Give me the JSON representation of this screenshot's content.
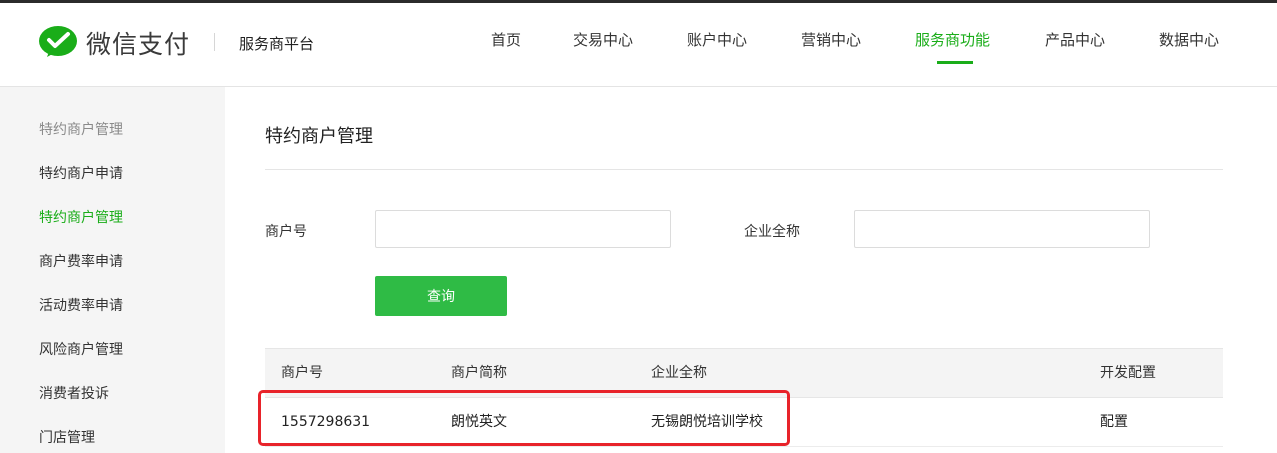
{
  "header": {
    "brand": "微信支付",
    "platform": "服务商平台",
    "nav": [
      {
        "label": "首页"
      },
      {
        "label": "交易中心"
      },
      {
        "label": "账户中心"
      },
      {
        "label": "营销中心"
      },
      {
        "label": "服务商功能",
        "active": true
      },
      {
        "label": "产品中心"
      },
      {
        "label": "数据中心"
      }
    ]
  },
  "sidebar": {
    "title": "特约商户管理",
    "items": [
      {
        "label": "特约商户申请"
      },
      {
        "label": "特约商户管理",
        "active": true
      },
      {
        "label": "商户费率申请"
      },
      {
        "label": "活动费率申请"
      },
      {
        "label": "风险商户管理"
      },
      {
        "label": "消费者投诉"
      },
      {
        "label": "门店管理"
      }
    ]
  },
  "main": {
    "title": "特约商户管理",
    "form": {
      "merchant_id_label": "商户号",
      "merchant_id_value": "",
      "company_label": "企业全称",
      "company_value": "",
      "query_label": "查询"
    },
    "table": {
      "columns": [
        "商户号",
        "商户简称",
        "企业全称",
        "开发配置"
      ],
      "rows": [
        {
          "merchant_id": "1557298631",
          "short_name": "朗悦英文",
          "full_name": "无锡朗悦培训学校",
          "action": "配置"
        }
      ]
    }
  },
  "colors": {
    "brand_green": "#1aad19",
    "button_green": "#2fbb45",
    "link_blue": "#2b5bb5",
    "highlight_red": "#e8232a"
  }
}
